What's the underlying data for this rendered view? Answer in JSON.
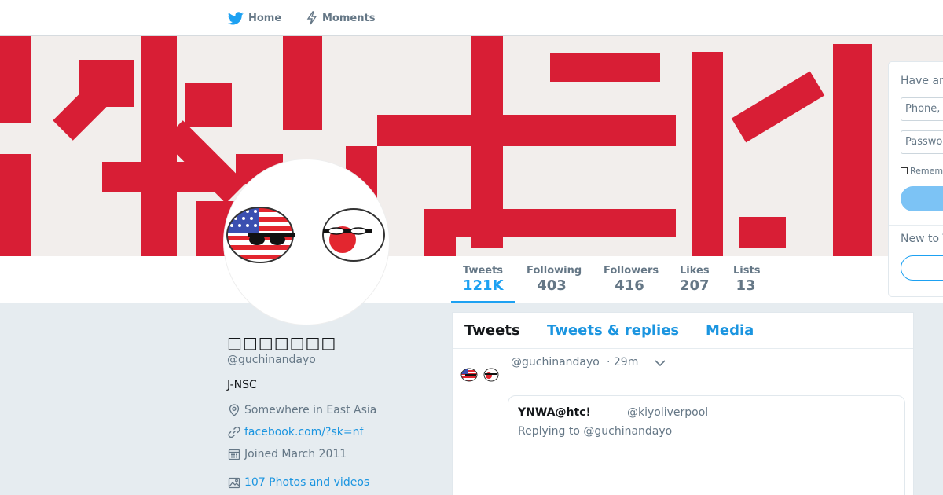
{
  "nav": {
    "home_label": "Home",
    "moments_label": "Moments"
  },
  "profile": {
    "name": "□□□□□□□",
    "handle": "@guchinandayo",
    "bio": "J-NSC",
    "location": "Somewhere in East Asia",
    "website": "facebook.com/?sk=nf",
    "joined": "Joined March 2011",
    "photos_videos": "107 Photos and videos"
  },
  "stats": [
    {
      "label": "Tweets",
      "value": "121K",
      "active": true
    },
    {
      "label": "Following",
      "value": "403"
    },
    {
      "label": "Followers",
      "value": "416"
    },
    {
      "label": "Likes",
      "value": "207"
    },
    {
      "label": "Lists",
      "value": "13"
    }
  ],
  "timeline": {
    "tabs": [
      {
        "label": "Tweets",
        "active": true
      },
      {
        "label": "Tweets & replies"
      },
      {
        "label": "Media"
      }
    ],
    "tweet": {
      "handle": "@guchinandayo",
      "time": "· 29m",
      "quote": {
        "name": "YNWA@htc!",
        "handle": "@kiyoliverpool",
        "reply_text": "Replying to @guchinandayo"
      }
    }
  },
  "login": {
    "heading": "Have an account?",
    "phone_placeholder": "Phone, email or username",
    "password_placeholder": "Password",
    "remember_label": "Remember me",
    "new_text": "New to Twitter?"
  },
  "colors": {
    "accent": "#1da1f2",
    "link": "#1b95e0",
    "banner_red": "#d81e35"
  }
}
